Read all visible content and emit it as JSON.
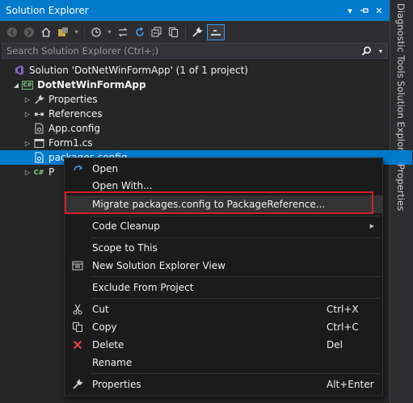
{
  "window": {
    "title": "Solution Explorer",
    "title_icons": [
      "dropdown-arrow-icon",
      "pin-icon",
      "close-icon"
    ]
  },
  "side_tabs": [
    "Diagnostic Tools",
    "Solution Explorer",
    "Properties"
  ],
  "search": {
    "placeholder": "Search Solution Explorer (Ctrl+;)",
    "value": ""
  },
  "tree": {
    "items": [
      {
        "label": "Solution 'DotNetWinFormApp' (1 of 1 project)",
        "icon": "solution-icon",
        "level": 0
      },
      {
        "label": "DotNetWinFormApp",
        "icon": "csharp-project-icon",
        "level": 0,
        "bold": true
      },
      {
        "label": "Properties",
        "icon": "wrench-icon",
        "level": 1
      },
      {
        "label": "References",
        "icon": "references-icon",
        "level": 1
      },
      {
        "label": "App.config",
        "icon": "config-file-icon",
        "level": 1
      },
      {
        "label": "Form1.cs",
        "icon": "form-icon",
        "level": 1
      },
      {
        "label": "packages.config",
        "icon": "config-file-icon",
        "level": 1,
        "selected": true
      },
      {
        "label": "P",
        "icon": "csharp-file-icon",
        "level": 1
      }
    ]
  },
  "context_menu": {
    "items": [
      {
        "label": "Open",
        "icon": "open-icon",
        "shortcut": ""
      },
      {
        "label": "Open With...",
        "icon": "",
        "shortcut": ""
      },
      {
        "label": "Migrate packages.config to PackageReference...",
        "icon": "",
        "shortcut": "",
        "highlighted": true
      },
      {
        "label": "Code Cleanup",
        "icon": "",
        "shortcut": "",
        "submenu": true
      },
      {
        "label": "Scope to This",
        "icon": "",
        "shortcut": ""
      },
      {
        "label": "New Solution Explorer View",
        "icon": "new-view-icon",
        "shortcut": ""
      },
      {
        "label": "Exclude From Project",
        "icon": "",
        "shortcut": ""
      },
      {
        "label": "Cut",
        "icon": "cut-icon",
        "shortcut": "Ctrl+X"
      },
      {
        "label": "Copy",
        "icon": "copy-icon",
        "shortcut": "Ctrl+C"
      },
      {
        "label": "Delete",
        "icon": "delete-icon",
        "shortcut": "Del"
      },
      {
        "label": "Rename",
        "icon": "",
        "shortcut": ""
      },
      {
        "label": "Properties",
        "icon": "wrench-icon",
        "shortcut": "Alt+Enter"
      }
    ]
  },
  "colors": {
    "accent": "#007acc",
    "highlight_box": "#d2202a",
    "menu_background": "#1b1b1c"
  }
}
